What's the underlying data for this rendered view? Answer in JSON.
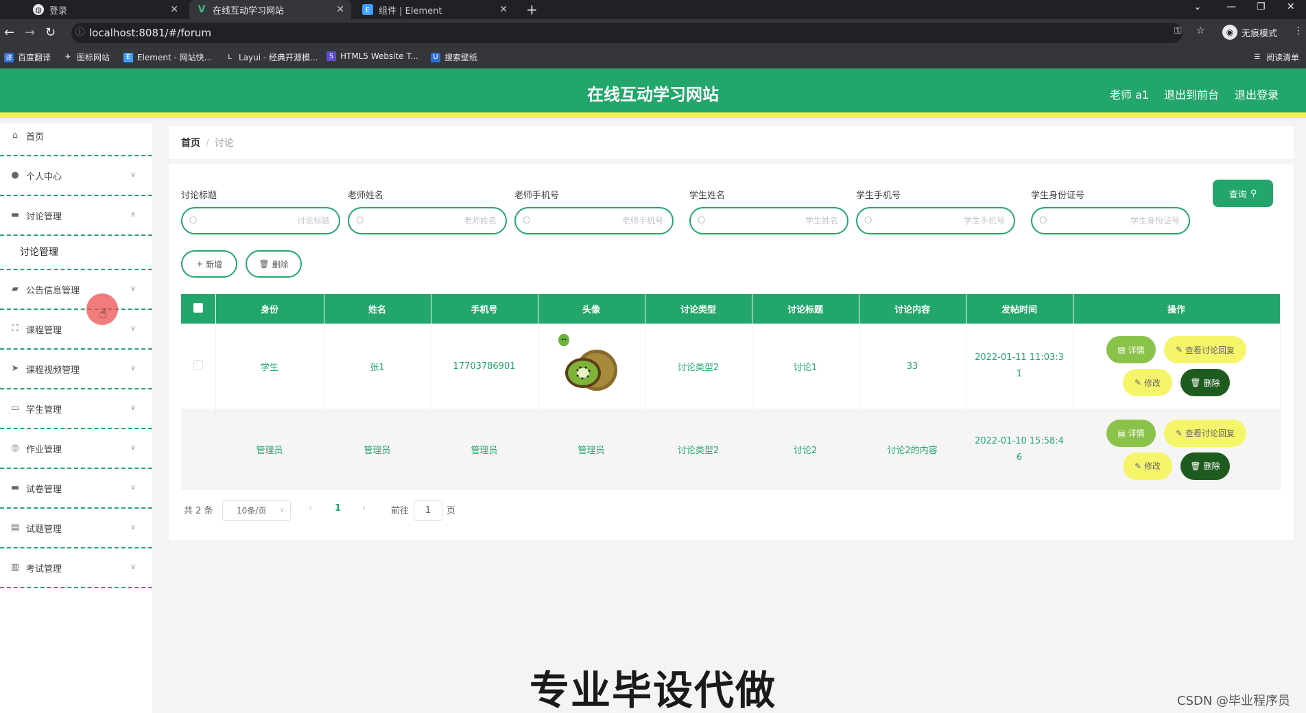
{
  "browser": {
    "tabs": [
      {
        "title": "登录",
        "icon": "globe-icon"
      },
      {
        "title": "在线互动学习网站",
        "icon": "vue-icon"
      },
      {
        "title": "组件 | Element",
        "icon": "element-icon"
      }
    ],
    "new_tab": "+",
    "url": "localhost:8081/#/forum",
    "incognito_label": "无痕模式",
    "bookmarks": [
      "百度翻译",
      "图标网站",
      "Element - 网站快...",
      "Layui - 经典开源模...",
      "HTML5 Website T...",
      "搜索壁纸"
    ],
    "reading_list": "阅读清单"
  },
  "header": {
    "title": "在线互动学习网站",
    "user": "老师 a1",
    "to_front": "退出到前台",
    "logout": "退出登录"
  },
  "sidebar": {
    "items": [
      {
        "label": "首页",
        "icon": "home-icon"
      },
      {
        "label": "个人中心",
        "icon": "user-icon"
      },
      {
        "label": "讨论管理",
        "icon": "chat-icon"
      },
      {
        "label": "公告信息管理",
        "icon": "notice-icon"
      },
      {
        "label": "课程管理",
        "icon": "course-icon"
      },
      {
        "label": "课程视频管理",
        "icon": "send-icon"
      },
      {
        "label": "学生管理",
        "icon": "card-icon"
      },
      {
        "label": "作业管理",
        "icon": "circle-icon"
      },
      {
        "label": "试卷管理",
        "icon": "comment-icon"
      },
      {
        "label": "试题管理",
        "icon": "clipboard-icon"
      },
      {
        "label": "考试管理",
        "icon": "chart-icon"
      }
    ],
    "sub_item": "讨论管理"
  },
  "breadcrumb": {
    "home": "首页",
    "sep": "/",
    "current": "讨论"
  },
  "filters": [
    {
      "label": "讨论标题",
      "placeholder": "讨论标题"
    },
    {
      "label": "老师姓名",
      "placeholder": "老师姓名"
    },
    {
      "label": "老师手机号",
      "placeholder": "老师手机号"
    },
    {
      "label": "学生姓名",
      "placeholder": "学生姓名"
    },
    {
      "label": "学生手机号",
      "placeholder": "学生手机号"
    },
    {
      "label": "学生身份证号",
      "placeholder": "学生身份证号"
    }
  ],
  "query_button": "查询",
  "actions": {
    "add": "新增",
    "delete": "删除"
  },
  "table": {
    "headers": [
      "身份",
      "姓名",
      "手机号",
      "头像",
      "讨论类型",
      "讨论标题",
      "讨论内容",
      "发帖时间",
      "操作"
    ],
    "rows": [
      {
        "role": "学生",
        "name": "张1",
        "phone": "17703786901",
        "avatar": "kiwi-image",
        "type": "讨论类型2",
        "title": "讨论1",
        "content": "33",
        "time": "2022-01-11 11:03:31"
      },
      {
        "role": "管理员",
        "name": "管理员",
        "phone": "管理员",
        "avatar": "管理员",
        "type": "讨论类型2",
        "title": "讨论2",
        "content": "讨论2的内容",
        "time": "2022-01-10 15:58:46"
      }
    ],
    "ops": {
      "detail": "详情",
      "replies": "查看讨论回复",
      "edit": "修改",
      "delete": "删除"
    }
  },
  "pagination": {
    "total": "共 2 条",
    "page_size": "10条/页",
    "current": "1",
    "goto": "前往",
    "goto_value": "1",
    "page_unit": "页"
  },
  "overlay": {
    "promo": "专业毕设代做",
    "credit": "CSDN @毕业程序员"
  },
  "colors": {
    "primary": "#22a66b",
    "accent_bar": "#f2f24a",
    "detail": "#8bc34a",
    "warn": "#f5f56a",
    "danger": "#1e5b1e"
  }
}
